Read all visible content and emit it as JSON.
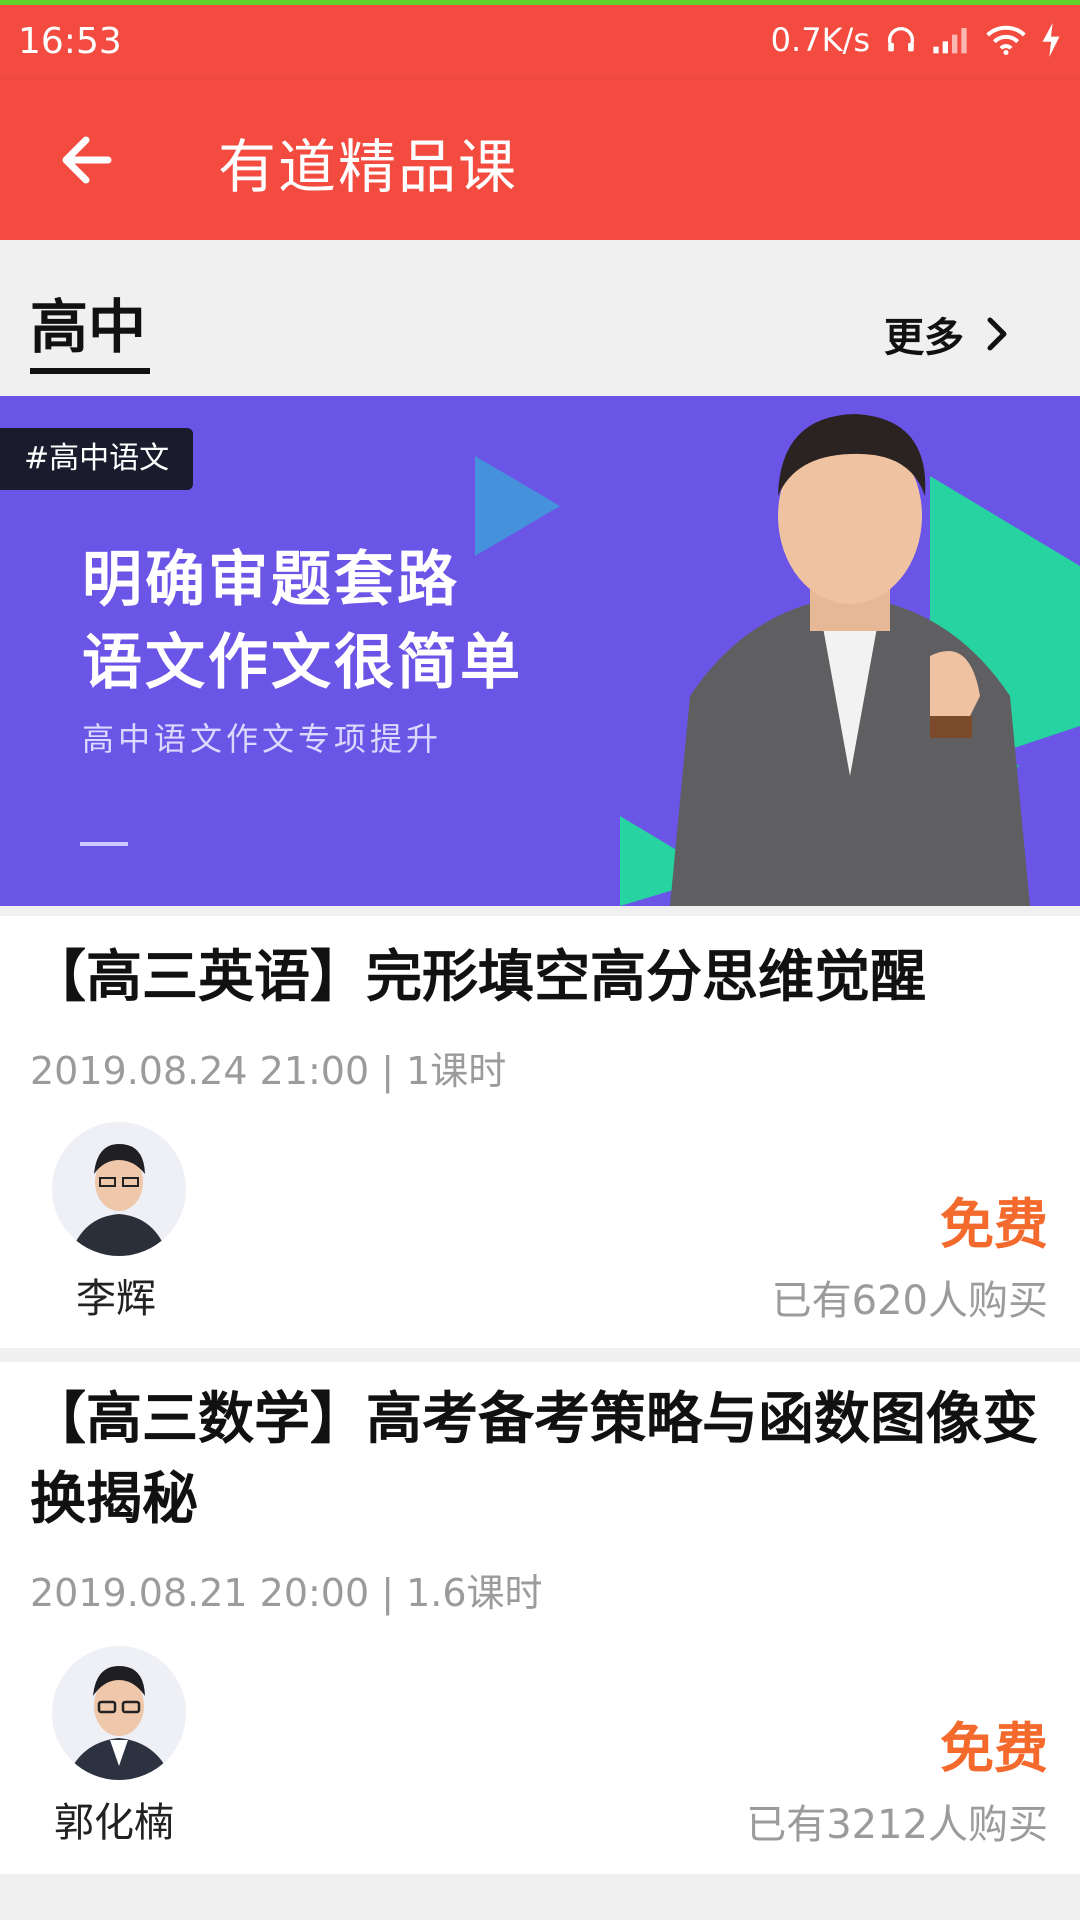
{
  "status_bar": {
    "time": "16:53",
    "net_speed": "0.7K/s",
    "icons": [
      "headphones-icon",
      "signal-icon",
      "wifi-icon",
      "charging-icon"
    ]
  },
  "app_bar": {
    "title": "有道精品课",
    "back_icon": "back-arrow-icon"
  },
  "section": {
    "tab_label": "高中",
    "more_label": "更多"
  },
  "banner": {
    "tag": "#高中语文",
    "headline_1": "明确审题套路",
    "headline_2": "语文作文很简单",
    "subtitle": "高中语文作文专项提升"
  },
  "courses": [
    {
      "title": "【高三英语】完形填空高分思维觉醒",
      "meta": "2019.08.24 21:00 | 1课时",
      "teacher": "李辉",
      "price": "免费",
      "buyers": "已有620人购买"
    },
    {
      "title": "【高三数学】高考备考策略与函数图像变换揭秘",
      "meta": "2019.08.21 20:00 | 1.6课时",
      "teacher": "郭化楠",
      "price": "免费",
      "buyers": "已有3212人购买"
    }
  ],
  "colors": {
    "app_bar": "#f34b3f",
    "banner_bg": "#6a55e6",
    "price": "#f46a2c",
    "meta_text": "#9b9b9b"
  }
}
